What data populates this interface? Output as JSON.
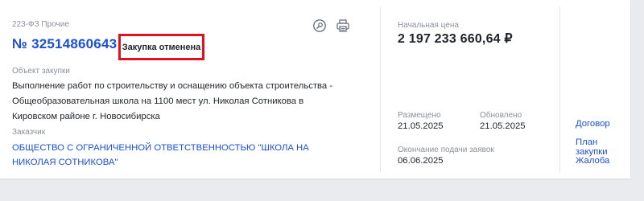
{
  "procurement": {
    "law_tag": "223-ФЗ Прочие",
    "number": "№ 32514860643",
    "status": "Закупка отменена",
    "object_label": "Объект закупки",
    "object_text": "Выполнение работ по строительству и оснащению объекта строительства - Общеобразовательная школа на 1100 мест ул. Николая Сотникова в Кировском районе г. Новосибирска",
    "customer_label": "Заказчик",
    "customer_name": "ОБЩЕСТВО С ОГРАНИЧЕННОЙ ОТВЕТСТВЕННОСТЬЮ \"ШКОЛА НА НИКОЛАЯ СОТНИКОВА\""
  },
  "price": {
    "label": "Начальная цена",
    "value": "2 197 233 660,64 ₽"
  },
  "dates": {
    "posted_label": "Размещено",
    "posted_value": "21.05.2025",
    "updated_label": "Обновлено",
    "updated_value": "21.05.2025",
    "deadline_label": "Окончание подачи заявок",
    "deadline_value": "06.06.2025"
  },
  "links": {
    "contract": "Договор",
    "plan": "План закупки",
    "complaint": "Жалоба"
  },
  "icons": {
    "search": "search-icon",
    "print": "print-icon"
  },
  "colors": {
    "accent": "#1a4fd6",
    "status_border": "#e3111d",
    "background": "#e9ebef"
  }
}
